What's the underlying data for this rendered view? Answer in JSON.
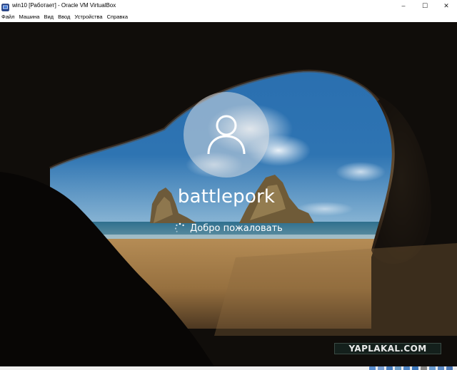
{
  "window": {
    "title": "win10 [Работает] - Oracle VM VirtualBox",
    "controls": {
      "minimize": "–",
      "maximize": "☐",
      "close": "✕"
    }
  },
  "menubar": {
    "items": [
      "Файл",
      "Машина",
      "Вид",
      "Ввод",
      "Устройства",
      "Справка"
    ]
  },
  "login": {
    "username": "battlepork",
    "status_text": "Добро пожаловать"
  },
  "watermark": {
    "text": "YAPLAKAL.COM"
  },
  "colors": {
    "accent": "#0078d7",
    "cave_dark": "#0b0908",
    "sky": "#1f5d99",
    "sand": "#a6804a"
  },
  "icons": {
    "app": "virtualbox-icon",
    "avatar": "user-icon",
    "spinner": "loading-spinner-icon"
  },
  "statusbar": {
    "icons": [
      "hdd-icon",
      "optical-icon",
      "usb-icon",
      "shared-folder-icon",
      "display-icon",
      "network-icon",
      "record-icon",
      "cpu-icon",
      "mouse-icon",
      "host-key-icon"
    ]
  }
}
